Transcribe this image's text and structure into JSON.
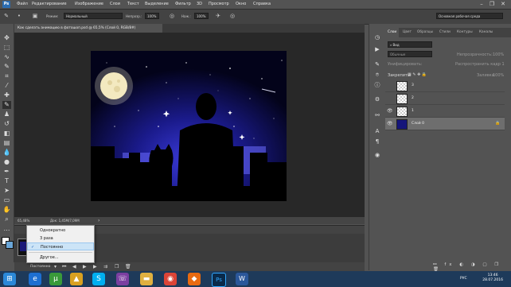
{
  "menu": {
    "logo": "Ps",
    "items": [
      "Файл",
      "Редактирование",
      "Изображение",
      "Слои",
      "Текст",
      "Выделение",
      "Фильтр",
      "3D",
      "Просмотр",
      "Окно",
      "Справка"
    ],
    "win_min": "–",
    "win_max": "❐",
    "win_close": "✕"
  },
  "options": {
    "mode_label": "Режим:",
    "mode_value": "Нормальный",
    "opacity_label": "Непрозр.:",
    "opacity_value": "100%",
    "pressure_label": "Наж.:",
    "pressure_value": "100%",
    "workspace": "Основная рабочая среда"
  },
  "document": {
    "tab_title": "Как сделать анимацию в фотошоп.psd @ 65,5% (Слой 0, RGB/8#)",
    "zoom": "65,48%",
    "doc_info": "Док: 1,45M/7,09M"
  },
  "timeline": {
    "loop_value": "Постоянно"
  },
  "dropdown": {
    "items": [
      "Однократно",
      "3 раза",
      "Постоянно",
      "Другое..."
    ],
    "selected_index": 2,
    "check": "✓"
  },
  "panel": {
    "tabs": [
      "Слои",
      "Цвет",
      "Образцы",
      "Стили",
      "Контуры",
      "Каналы"
    ],
    "search_label": "Вид",
    "mode": "Обычные",
    "opacity_label": "Непрозрачность:",
    "opacity_value": "100%",
    "lock_label": "Закрепить:",
    "fill_label": "Заливка:",
    "fill_value": "100%",
    "unify_label": "Унифицировать:",
    "propagate_label": "Распространить кадр 1",
    "layers": [
      {
        "name": "3",
        "visible": false
      },
      {
        "name": "2",
        "visible": false
      },
      {
        "name": "1",
        "visible": true
      },
      {
        "name": "Слой 0",
        "visible": true,
        "selected": true
      }
    ]
  },
  "taskbar": {
    "lang": "РУС",
    "time": "13:46",
    "date": "28.07.2016"
  },
  "colors": {
    "accent": "#2b6cb0",
    "selected_layer": "#6e6e6e",
    "canvas_sky": "#141470"
  }
}
